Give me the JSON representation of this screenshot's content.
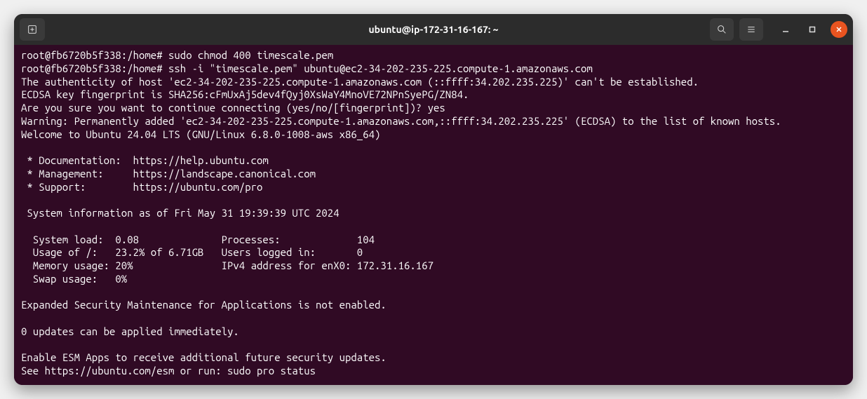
{
  "titlebar": {
    "title": "ubuntu@ip-172-31-16-167: ~"
  },
  "terminal": {
    "lines": [
      "root@fb6720b5f338:/home# sudo chmod 400 timescale.pem",
      "root@fb6720b5f338:/home# ssh -i \"timescale.pem\" ubuntu@ec2-34-202-235-225.compute-1.amazonaws.com",
      "The authenticity of host 'ec2-34-202-235-225.compute-1.amazonaws.com (::ffff:34.202.235.225)' can't be established.",
      "ECDSA key fingerprint is SHA256:cFmUxAj5dev4fQyj0XsWaY4MnoVE72NPnSyePG/ZN84.",
      "Are you sure you want to continue connecting (yes/no/[fingerprint])? yes",
      "Warning: Permanently added 'ec2-34-202-235-225.compute-1.amazonaws.com,::ffff:34.202.235.225' (ECDSA) to the list of known hosts.",
      "Welcome to Ubuntu 24.04 LTS (GNU/Linux 6.8.0-1008-aws x86_64)",
      "",
      " * Documentation:  https://help.ubuntu.com",
      " * Management:     https://landscape.canonical.com",
      " * Support:        https://ubuntu.com/pro",
      "",
      " System information as of Fri May 31 19:39:39 UTC 2024",
      "",
      "  System load:  0.08              Processes:             104",
      "  Usage of /:   23.2% of 6.71GB   Users logged in:       0",
      "  Memory usage: 20%               IPv4 address for enX0: 172.31.16.167",
      "  Swap usage:   0%",
      "",
      "Expanded Security Maintenance for Applications is not enabled.",
      "",
      "0 updates can be applied immediately.",
      "",
      "Enable ESM Apps to receive additional future security updates.",
      "See https://ubuntu.com/esm or run: sudo pro status"
    ]
  }
}
